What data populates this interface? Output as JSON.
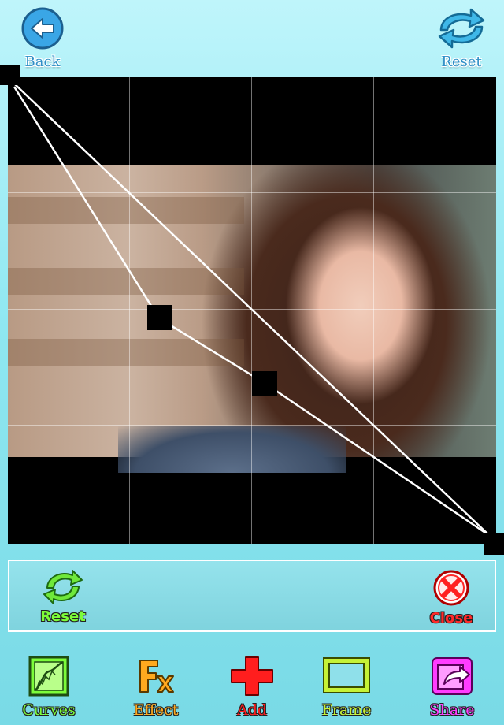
{
  "header": {
    "back_label": "Back",
    "reset_label": "Reset"
  },
  "panel": {
    "reset_label": "Reset",
    "close_label": "Close"
  },
  "toolbar": {
    "items": [
      {
        "label": "Curves",
        "icon": "curves-icon",
        "color": "#7CFC3A"
      },
      {
        "label": "Effect",
        "icon": "effect-icon",
        "color": "#FFA91F"
      },
      {
        "label": "Add",
        "icon": "add-icon",
        "color": "#FF1E1E"
      },
      {
        "label": "Frame",
        "icon": "frame-icon",
        "color": "#C6F236"
      },
      {
        "label": "Share",
        "icon": "share-icon",
        "color": "#FF3CFF"
      }
    ]
  },
  "colors": {
    "accent_blue": "#2F8FC7",
    "panel_reset_green": "#7CFC3A",
    "panel_close_red": "#FF2A2A"
  }
}
